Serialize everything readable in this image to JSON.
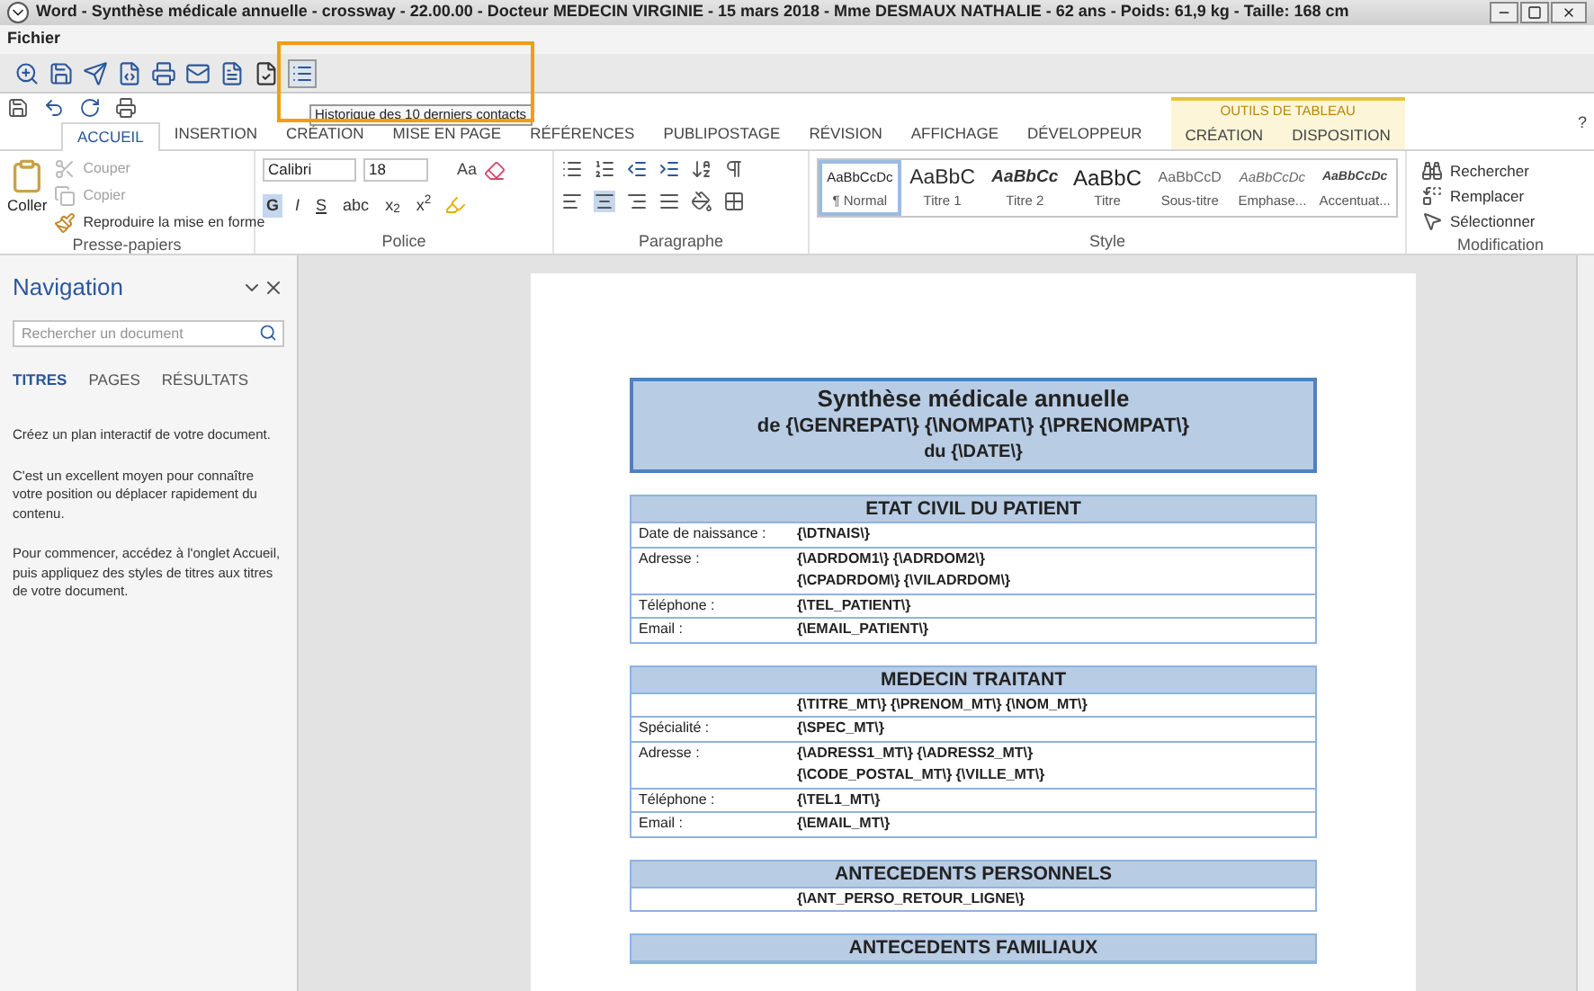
{
  "window": {
    "title": "Word - Synthèse médicale annuelle - crossway  - 22.00.00 - Docteur MEDECIN VIRGINIE - 15 mars 2018 - Mme DESMAUX NATHALIE - 62 ans - Poids: 61,9 kg - Taille: 168 cm"
  },
  "menu": [
    "Fichier"
  ],
  "toolbar": {
    "tooltip": "Historique des 10 derniers contacts"
  },
  "help": "?",
  "tabs": [
    {
      "label": "ACCUEIL",
      "selected": true
    },
    {
      "label": "INSERTION",
      "selected": false
    },
    {
      "label": "CRÉATION",
      "selected": false
    },
    {
      "label": "MISE EN PAGE",
      "selected": false
    },
    {
      "label": "RÉFÉRENCES",
      "selected": false
    },
    {
      "label": "PUBLIPOSTAGE",
      "selected": false
    },
    {
      "label": "RÉVISION",
      "selected": false
    },
    {
      "label": "AFFICHAGE",
      "selected": false
    },
    {
      "label": "DÉVELOPPEUR",
      "selected": false
    }
  ],
  "contextual": {
    "title": "OUTILS DE TABLEAU",
    "tabs": [
      {
        "label": "CRÉATION",
        "selected": false
      },
      {
        "label": "DISPOSITION",
        "selected": false
      }
    ]
  },
  "clipboard": {
    "group": "Presse-papiers",
    "paste": "Coller",
    "items": [
      {
        "label": "Couper",
        "disabled": true
      },
      {
        "label": "Copier",
        "disabled": true
      },
      {
        "label": "Reproduire la mise en forme",
        "disabled": false
      }
    ]
  },
  "font": {
    "group": "Police",
    "family": "Calibri",
    "size": "18",
    "case": "Aa",
    "format": [
      {
        "label": "G",
        "selected": true
      },
      {
        "label": "I",
        "selected": false
      },
      {
        "label": "S",
        "selected": false
      },
      {
        "label": "abc",
        "selected": false
      },
      {
        "label": "x$_{2}$",
        "selected": false
      },
      {
        "label": "x$^{2}$",
        "selected": false
      }
    ]
  },
  "paragraph": {
    "group": "Paragraphe"
  },
  "styles": {
    "group": "Style",
    "items": [
      {
        "kind": "normal",
        "preview": "AaBbCcDc",
        "name": "¶ Normal",
        "selected": true
      },
      {
        "kind": "heading1",
        "preview": "AaBbC",
        "name": "Titre 1",
        "selected": false
      },
      {
        "kind": "heading2",
        "preview": "AaBbCc",
        "name": "Titre 2",
        "selected": false
      },
      {
        "kind": "title",
        "preview": "AaBbC",
        "name": "Titre",
        "selected": false
      },
      {
        "kind": "subtitle",
        "preview": "AaBbCcD",
        "name": "Sous-titre",
        "selected": false
      },
      {
        "kind": "emphasis",
        "preview": "AaBbCcDc",
        "name": "Emphase...",
        "selected": false
      },
      {
        "kind": "accent",
        "preview": "AaBbCcDc",
        "name": "Accentuat...",
        "selected": false
      }
    ]
  },
  "editing": {
    "group": "Modification",
    "items": [
      "Rechercher",
      "Remplacer",
      "Sélectionner"
    ]
  },
  "navigation": {
    "title": "Navigation",
    "search": {
      "placeholder": "Rechercher un document"
    },
    "tabs": [
      {
        "label": "TITRES",
        "selected": true
      },
      {
        "label": "PAGES",
        "selected": false
      },
      {
        "label": "RÉSULTATS",
        "selected": false
      }
    ],
    "paragraphs": [
      "Créez un plan interactif de votre document.",
      "C'est un excellent moyen pour connaître votre position ou déplacer rapidement du contenu.",
      "Pour commencer, accédez à l'onglet Accueil, puis appliquez des styles de titres aux titres de votre document."
    ]
  },
  "document": {
    "header": [
      "Synthèse médicale annuelle",
      "de {\\GENREPAT\\} {\\NOMPAT\\} {\\PRENOMPAT\\}",
      "du {\\DATE\\}"
    ],
    "sections": [
      {
        "heading": "ETAT CIVIL DU PATIENT",
        "rows": [
          {
            "label": "Date de naissance :",
            "values": [
              "{\\DTNAIS\\}"
            ]
          },
          {
            "label": "Adresse :",
            "values": [
              "{\\ADRDOM1\\} {\\ADRDOM2\\}",
              "{\\CPADRDOM\\} {\\VILADRDOM\\}"
            ]
          },
          {
            "label": "Téléphone :",
            "values": [
              "{\\TEL_PATIENT\\}"
            ]
          },
          {
            "label": "Email :",
            "values": [
              "{\\EMAIL_PATIENT\\}"
            ]
          }
        ]
      },
      {
        "heading": "MEDECIN TRAITANT",
        "rows": [
          {
            "values": [
              "{\\TITRE_MT\\} {\\PRENOM_MT\\} {\\NOM_MT\\}"
            ]
          },
          {
            "label": "Spécialité :",
            "values": [
              "{\\SPEC_MT\\}"
            ]
          },
          {
            "label": "Adresse :",
            "values": [
              "{\\ADRESS1_MT\\} {\\ADRESS2_MT\\}",
              "{\\CODE_POSTAL_MT\\} {\\VILLE_MT\\}"
            ]
          },
          {
            "label": "Téléphone :",
            "values": [
              "{\\TEL1_MT\\}"
            ]
          },
          {
            "label": "Email :",
            "values": [
              "{\\EMAIL_MT\\}"
            ]
          }
        ]
      },
      {
        "heading": "ANTECEDENTS PERSONNELS",
        "rows": [
          {
            "values": [
              "{\\ANT_PERSO_RETOUR_LIGNE\\}"
            ]
          }
        ]
      },
      {
        "heading": "ANTECEDENTS FAMILIAUX"
      }
    ]
  }
}
